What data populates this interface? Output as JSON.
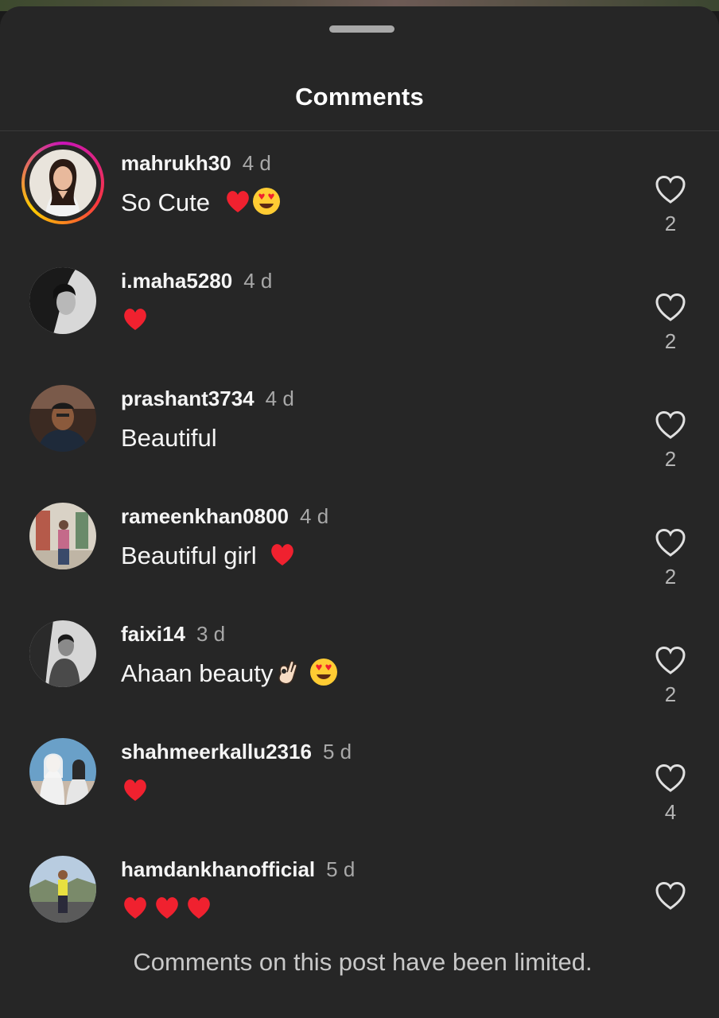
{
  "header": {
    "title": "Comments"
  },
  "comments": [
    {
      "username": "mahrukh30",
      "time": "4 d",
      "text": "So Cute",
      "likes": "2"
    },
    {
      "username": "i.maha5280",
      "time": "4 d",
      "text": "",
      "likes": "2"
    },
    {
      "username": "prashant3734",
      "time": "4 d",
      "text": "Beautiful",
      "likes": "2"
    },
    {
      "username": "rameenkhan0800",
      "time": "4 d",
      "text": "Beautiful girl",
      "likes": "2"
    },
    {
      "username": "faixi14",
      "time": "3 d",
      "text": "Ahaan beauty",
      "likes": "2"
    },
    {
      "username": "shahmeerkallu2316",
      "time": "5 d",
      "text": "",
      "likes": "4"
    },
    {
      "username": "hamdankhanofficial",
      "time": "5 d",
      "text": "",
      "likes": ""
    }
  ],
  "footer": {
    "limited_notice": "Comments on this post have been limited."
  },
  "icons": {
    "like": "heart-outline-icon",
    "emoji_heart": "red-heart-emoji",
    "emoji_heart_eyes": "heart-eyes-emoji",
    "emoji_ok": "ok-hand-emoji"
  },
  "colors": {
    "background": "#262626",
    "text": "#f5f5f5",
    "muted": "#a8a8a8",
    "heart": "#f0212f"
  }
}
